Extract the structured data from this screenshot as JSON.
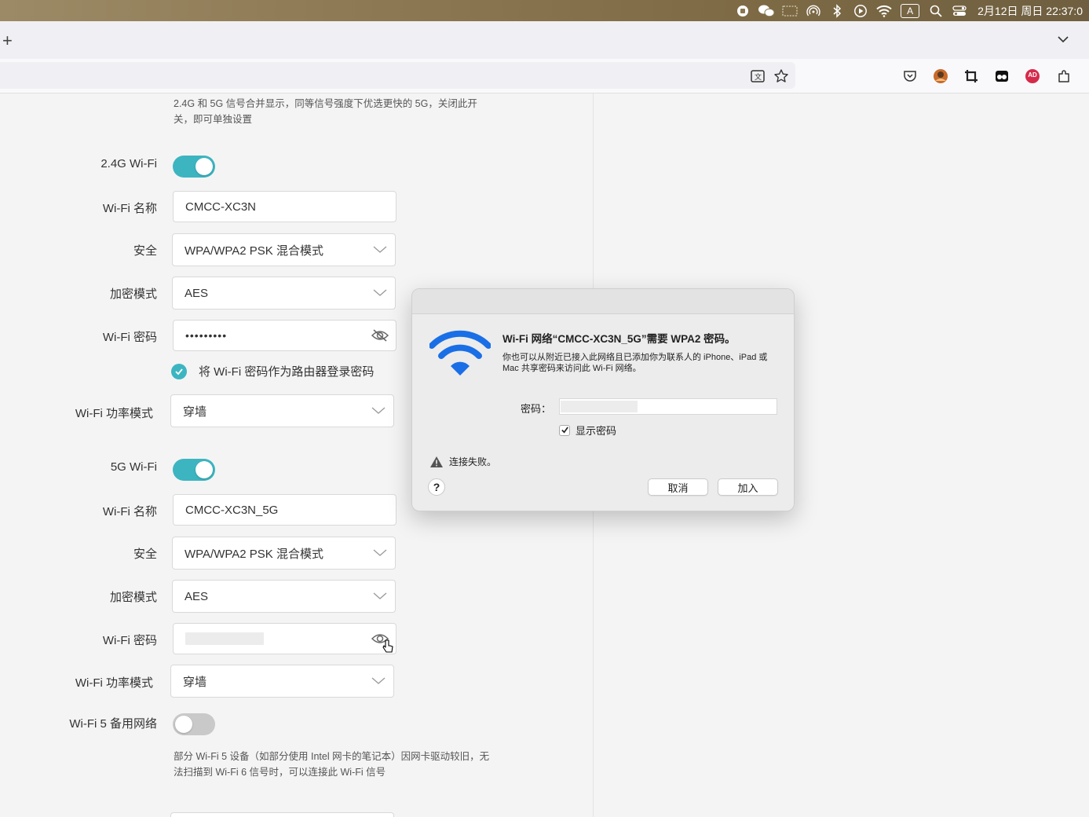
{
  "menubar": {
    "icons": [
      "record-icon",
      "wechat-icon",
      "display-icon",
      "airdrop-icon",
      "bluetooth-icon",
      "play-icon",
      "wifi-icon",
      "input-method-icon",
      "search-icon",
      "control-center-icon"
    ],
    "input_method": "A",
    "clock": "2月12日 周日 22:37:0"
  },
  "browser": {
    "newtab_label": "+",
    "toolbar_icons": [
      "translate-icon",
      "bookmark-star-icon",
      "pocket-icon",
      "avatar-icon",
      "crop-icon",
      "extension-icon",
      "adblock-icon",
      "puzzle-icon"
    ],
    "adblock_label": "AD"
  },
  "wifi_settings": {
    "top_note": "2.4G 和 5G 信号合并显示，同等信号强度下优选更快的 5G，关闭此开关，即可单独设置",
    "band_24": {
      "toggle_label": "2.4G Wi-Fi",
      "enabled": true,
      "name_label": "Wi-Fi 名称",
      "name_value": "CMCC-XC3N",
      "security_label": "安全",
      "security_value": "WPA/WPA2 PSK 混合模式",
      "encryption_label": "加密模式",
      "encryption_value": "AES",
      "password_label": "Wi-Fi 密码",
      "password_value": "•••••••••",
      "login_checkbox_label": "将 Wi-Fi 密码作为路由器登录密码",
      "power_label": "Wi-Fi 功率模式",
      "power_value": "穿墙"
    },
    "band_5": {
      "toggle_label": "5G Wi-Fi",
      "enabled": true,
      "name_label": "Wi-Fi 名称",
      "name_value": "CMCC-XC3N_5G",
      "security_label": "安全",
      "security_value": "WPA/WPA2 PSK 混合模式",
      "encryption_label": "加密模式",
      "encryption_value": "AES",
      "password_label": "Wi-Fi 密码",
      "power_label": "Wi-Fi 功率模式",
      "power_value": "穿墙"
    },
    "backup": {
      "toggle_label": "Wi-Fi 5 备用网络",
      "enabled": false,
      "note": "部分 Wi-Fi 5 设备（如部分使用 Intel 网卡的笔记本）因网卡驱动较旧，无法扫描到 Wi-Fi 6 信号时，可以连接此 Wi-Fi 信号"
    }
  },
  "dialog": {
    "title": "Wi-Fi 网络“CMCC-XC3N_5G”需要 WPA2 密码。",
    "description": "你也可以从附近已接入此网络且已添加你为联系人的 iPhone、iPad 或 Mac 共享密码来访问此 Wi-Fi 网络。",
    "password_label": "密码：",
    "show_password_label": "显示密码",
    "show_password_checked": true,
    "warning": "连接失败。",
    "help_label": "?",
    "cancel_label": "取消",
    "join_label": "加入"
  },
  "colors": {
    "toggle_on": "#3cb5c1",
    "toggle_off": "#c9c9c9",
    "wifi_blue": "#1a6fe6"
  }
}
